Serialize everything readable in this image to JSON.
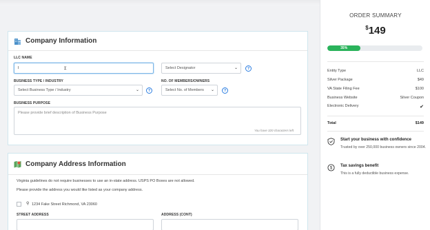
{
  "company": {
    "title": "Company Information",
    "llc_name_label": "LLC NAME",
    "llc_name_value": "I",
    "designator_placeholder": "Select Designator",
    "business_type_label": "BUSINESS TYPE / INDUSTRY",
    "business_type_placeholder": "Select Business Type / Industry",
    "members_label": "NO. OF MEMBERS/OWNERS",
    "members_placeholder": "Select No. of Members",
    "purpose_label": "BUSINESS PURPOSE",
    "purpose_placeholder": "Please provide brief description of Business Purpose",
    "purpose_counter": "You have 320 characters left"
  },
  "address": {
    "title": "Company Address Information",
    "note1": "Virginia guidelines do not require businesses to use an in-state address. USPS PO Boxes are not allowed.",
    "note2": "Please provide the address you would like listed as your company address.",
    "suggested_address": "1234 Fake Street Richmond, VA 23060",
    "street_label": "STREET ADDRESS",
    "street_cont_label": "ADDRESS (CONT)"
  },
  "summary": {
    "title": "ORDER SUMMARY",
    "price_symbol": "$",
    "price": "149",
    "progress_label": "35%",
    "progress_value": 35,
    "items": [
      {
        "label": "Entity Type",
        "value": "LLC"
      },
      {
        "label": "Silver Package",
        "value": "$49"
      },
      {
        "label": "VA State Filing Fee",
        "value": "$100"
      },
      {
        "label": "Business Website",
        "value": "Silver Coupon"
      },
      {
        "label": "Electronic Delivery",
        "value": "✔"
      }
    ],
    "total_label": "Total",
    "total_value": "$149",
    "features": [
      {
        "title": "Start your business with confidence",
        "desc": "Trusted by over 250,000 business owners since 2004."
      },
      {
        "title": "Tax savings benefit",
        "desc": "This is a fully deductible business expense."
      }
    ]
  },
  "icons": {
    "company": "building-icon",
    "address": "map-icon",
    "help": "question-icon",
    "chevron": "chevron-down-icon",
    "shield": "shield-icon",
    "savings": "coin-icon",
    "pin": "location-pin-icon"
  },
  "colors": {
    "accent_blue": "#2b7de1",
    "progress_green": "#2ab35b",
    "card_border": "#cfe6ee"
  }
}
